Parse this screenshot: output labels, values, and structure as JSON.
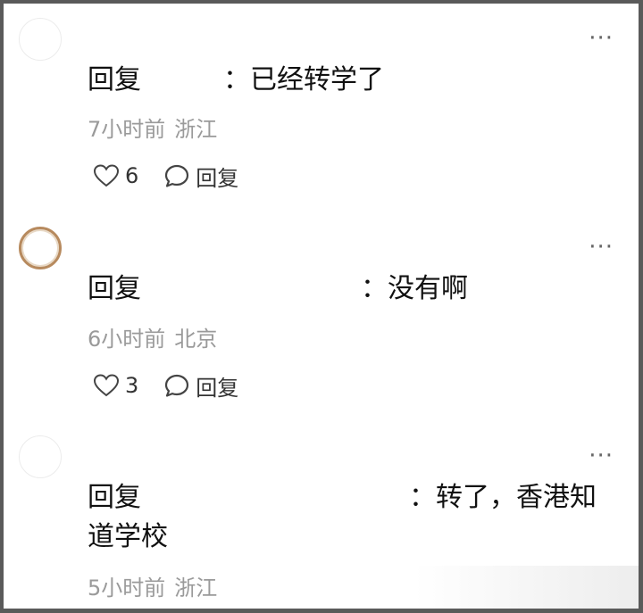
{
  "comments": [
    {
      "reply_prefix": "回复",
      "reply_body": "：已经转学了",
      "time": "7小时前",
      "location": "浙江",
      "likes": "6",
      "reply_label": "回复",
      "more": "···"
    },
    {
      "reply_prefix": "回复",
      "reply_body": "：没有啊",
      "time": "6小时前",
      "location": "北京",
      "likes": "3",
      "reply_label": "回复",
      "more": "···"
    },
    {
      "reply_prefix": "回复",
      "reply_body": "：转了，香港知道学校",
      "time": "5小时前",
      "location": "浙江",
      "more": "···"
    }
  ]
}
